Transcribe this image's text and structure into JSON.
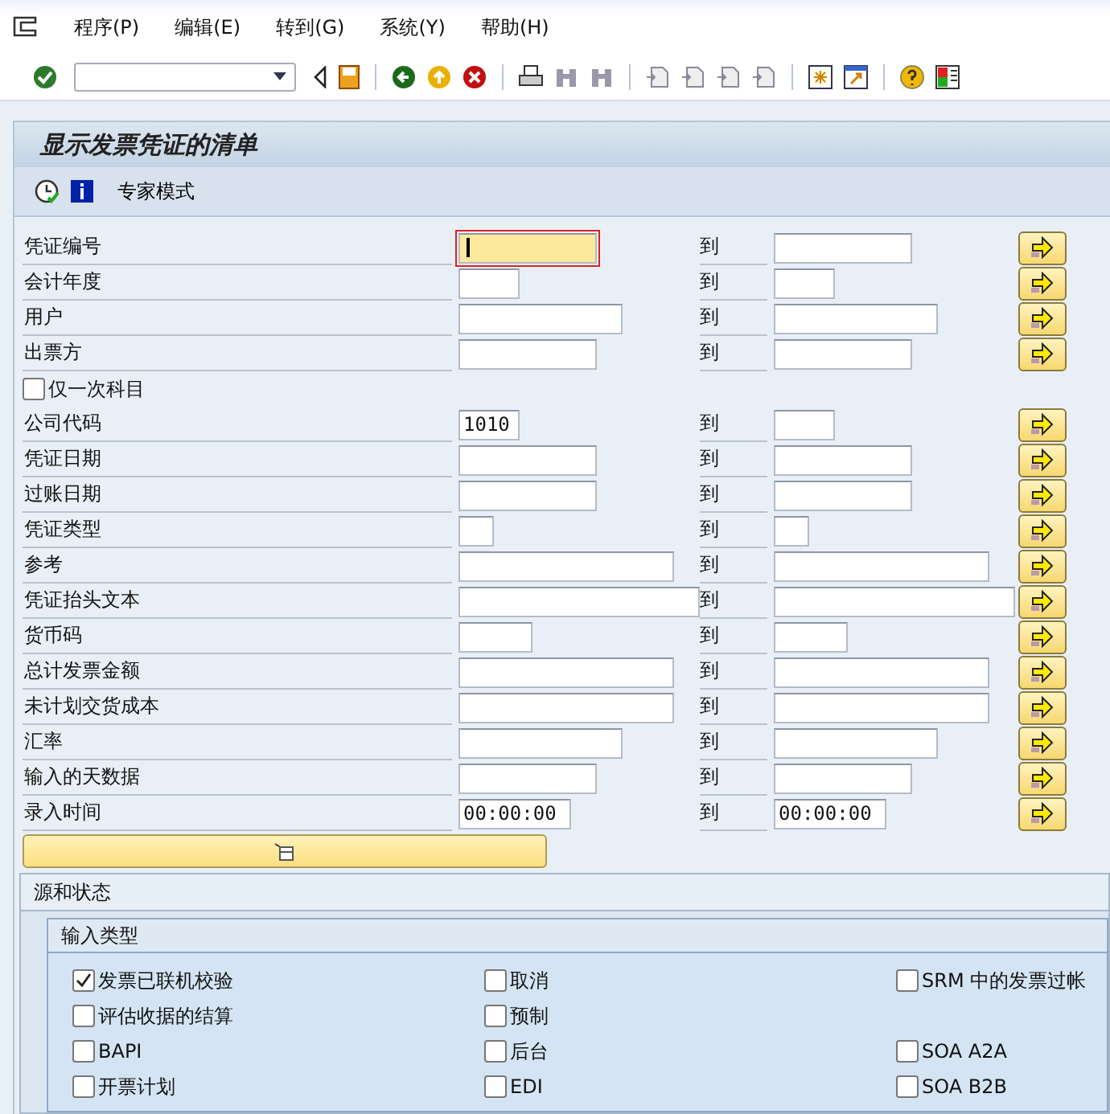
{
  "menu": [
    "程序(P)",
    "编辑(E)",
    "转到(G)",
    "系统(Y)",
    "帮助(H)"
  ],
  "title": "显示发票凭证的清单",
  "app_toolbar": {
    "button": "专家模式"
  },
  "criteria": [
    {
      "kind": "range",
      "label": "凭证编号",
      "to": "到",
      "focused": true
    },
    {
      "kind": "range",
      "label": "会计年度",
      "to": "到",
      "focused": false
    },
    {
      "kind": "range",
      "label": "用户",
      "to": "到",
      "focused": false
    },
    {
      "kind": "range",
      "label": "出票方",
      "to": "到",
      "focused": false
    },
    {
      "kind": "checkbox",
      "label": "仅一次科目",
      "checked": false
    },
    {
      "kind": "range",
      "label": "公司代码",
      "low": "1010",
      "to": "到",
      "focused": false
    },
    {
      "kind": "range",
      "label": "凭证日期",
      "to": "到",
      "focused": false
    },
    {
      "kind": "range",
      "label": "过账日期",
      "to": "到",
      "focused": false
    },
    {
      "kind": "range",
      "label": "凭证类型",
      "to": "到",
      "focused": false
    },
    {
      "kind": "range",
      "label": "参考",
      "to": "到",
      "focused": false
    },
    {
      "kind": "range",
      "label": "凭证抬头文本",
      "to": "到",
      "focused": false
    },
    {
      "kind": "range",
      "label": "货币码",
      "to": "到",
      "focused": false
    },
    {
      "kind": "range",
      "label": "总计发票金额",
      "to": "到",
      "focused": false
    },
    {
      "kind": "range",
      "label": "未计划交货成本",
      "to": "到",
      "focused": false
    },
    {
      "kind": "range",
      "label": "汇率",
      "to": "到",
      "focused": false
    },
    {
      "kind": "range",
      "label": "输入的天数据",
      "to": "到",
      "focused": false
    },
    {
      "kind": "range",
      "label": "录入时间",
      "low": "00:00:00",
      "to": "到",
      "high": "00:00:00",
      "focused": false
    }
  ],
  "section": {
    "title": "源和状态",
    "group": {
      "title": "输入类型",
      "rows": [
        [
          {
            "label": "发票已联机校验",
            "checked": true
          },
          {
            "label": "取消",
            "checked": false
          },
          {
            "label": "SRM 中的发票过帐",
            "checked": false
          }
        ],
        [
          {
            "label": "评估收据的结算",
            "checked": false
          },
          {
            "label": "预制",
            "checked": false
          },
          null
        ],
        [
          {
            "label": "BAPI",
            "checked": false
          },
          {
            "label": "后台",
            "checked": false
          },
          {
            "label": "SOA A2A",
            "checked": false
          }
        ],
        [
          {
            "label": "开票计划",
            "checked": false
          },
          {
            "label": "EDI",
            "checked": false
          },
          {
            "label": "SOA B2B",
            "checked": false
          }
        ]
      ]
    }
  }
}
